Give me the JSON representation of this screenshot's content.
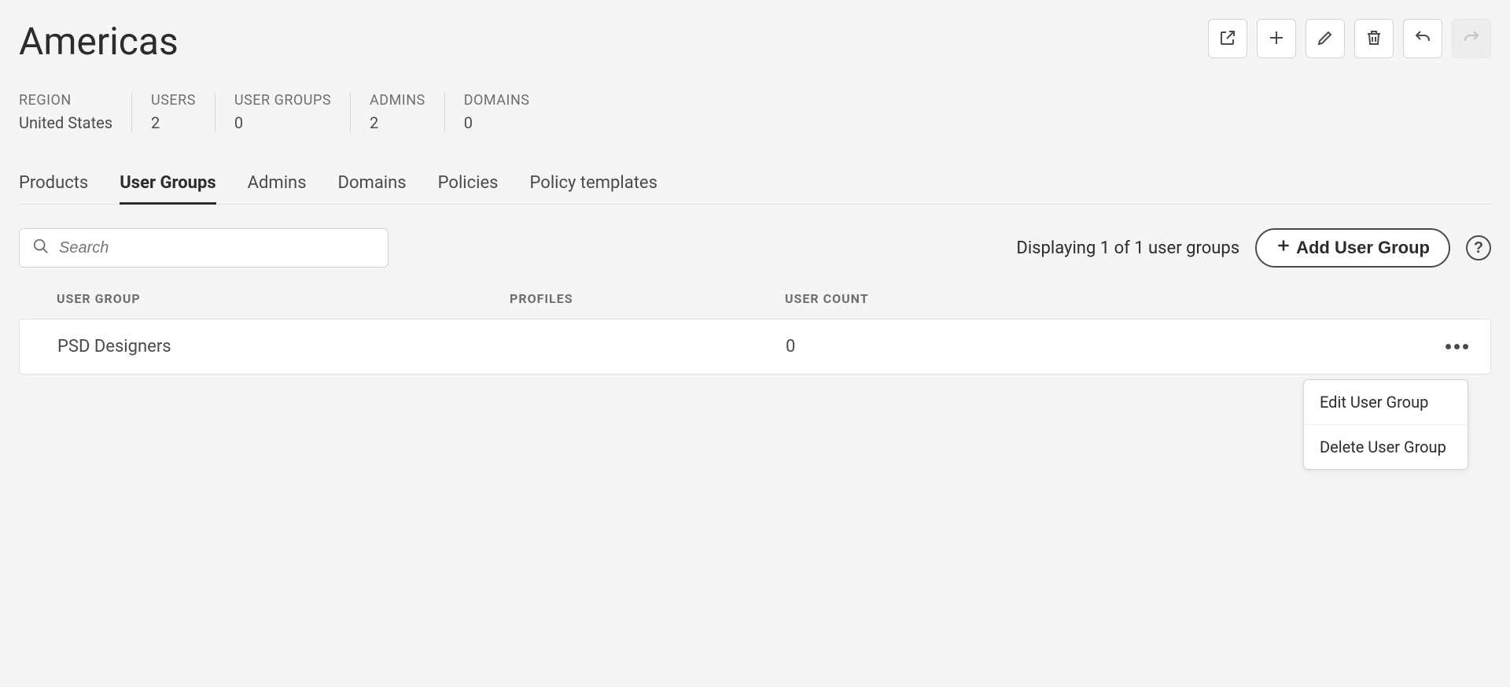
{
  "page_title": "Americas",
  "stats": [
    {
      "label": "REGION",
      "value": "United States"
    },
    {
      "label": "USERS",
      "value": "2"
    },
    {
      "label": "USER GROUPS",
      "value": "0"
    },
    {
      "label": "ADMINS",
      "value": "2"
    },
    {
      "label": "DOMAINS",
      "value": "0"
    }
  ],
  "tabs": [
    {
      "label": "Products",
      "active": false
    },
    {
      "label": "User Groups",
      "active": true
    },
    {
      "label": "Admins",
      "active": false
    },
    {
      "label": "Domains",
      "active": false
    },
    {
      "label": "Policies",
      "active": false
    },
    {
      "label": "Policy templates",
      "active": false
    }
  ],
  "search": {
    "placeholder": "Search"
  },
  "displaying_text": "Displaying 1 of 1 user groups",
  "add_button_label": "Add User Group",
  "help_label": "?",
  "table": {
    "headers": {
      "name": "USER GROUP",
      "profiles": "PROFILES",
      "count": "USER COUNT"
    },
    "rows": [
      {
        "name": "PSD Designers",
        "profiles": "",
        "count": "0"
      }
    ]
  },
  "context_menu": {
    "edit": "Edit User Group",
    "delete": "Delete User Group"
  }
}
